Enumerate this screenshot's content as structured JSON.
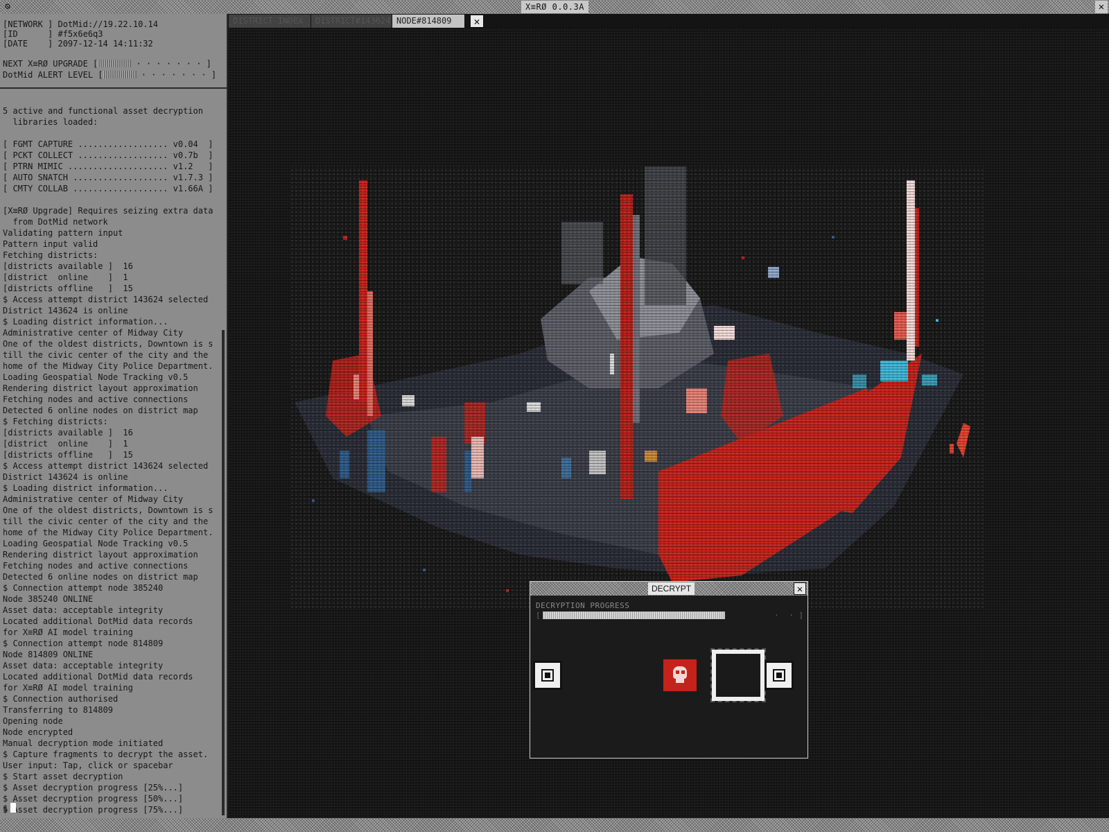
{
  "app": {
    "title": "X≡RØ 0.0.3A",
    "icon": "gear-icon",
    "close_icon": "close-icon"
  },
  "status": {
    "network": "[NETWORK ] DotMid://19.22.10.14",
    "id": "[ID      ] #f5x6e6q3",
    "date": "[DATE    ] 2097-12-14 14:11:32",
    "upgrade_label": "NEXT X≡RØ UPGRADE [",
    "upgrade_dots": " · · · · · · · ]",
    "upgrade_progress": 0.3,
    "alert_label": "DotMid ALERT LEVEL [",
    "alert_dots": " · · · · · · · ]",
    "alert_progress": 0.3
  },
  "log": {
    "lines": [
      "5 active and functional asset decryption",
      "  libraries loaded:",
      "",
      "[ FGMT CAPTURE .................. v0.04  ]",
      "[ PCKT COLLECT .................. v0.7b  ]",
      "[ PTRN MIMIC .................... v1.2   ]",
      "[ AUTO SNATCH ................... v1.7.3 ]",
      "[ CMTY COLLAB ................... v1.66A ]",
      "",
      "[X≡RØ Upgrade] Requires seizing extra data",
      "  from DotMid network",
      "Validating pattern input",
      "Pattern input valid",
      "Fetching districts:",
      "[districts available ]  16",
      "[district  online    ]  1",
      "[districts offline   ]  15",
      "$ Access attempt district 143624 selected",
      "District 143624 is online",
      "$ Loading district information...",
      "Administrative center of Midway City",
      "One of the oldest districts, Downtown is s",
      "till the civic center of the city and the",
      "home of the Midway City Police Department.",
      "Loading Geospatial Node Tracking v0.5",
      "Rendering district layout approximation",
      "Fetching nodes and active connections",
      "Detected 6 online nodes on district map",
      "$ Fetching districts:",
      "[districts available ]  16",
      "[district  online    ]  1",
      "[districts offline   ]  15",
      "$ Access attempt district 143624 selected",
      "District 143624 is online",
      "$ Loading district information...",
      "Administrative center of Midway City",
      "One of the oldest districts, Downtown is s",
      "till the civic center of the city and the",
      "home of the Midway City Police Department.",
      "Loading Geospatial Node Tracking v0.5",
      "Rendering district layout approximation",
      "Fetching nodes and active connections",
      "Detected 6 online nodes on district map",
      "$ Connection attempt node 385240",
      "Node 385240 ONLINE",
      "Asset data: acceptable integrity",
      "Located additional DotMid data records",
      "for X≡RØ AI model training",
      "$ Connection attempt node 814809",
      "Node 814809 ONLINE",
      "Asset data: acceptable integrity",
      "Located additional DotMid data records",
      "for X≡RØ AI model training",
      "$ Connection authorised",
      "Transferring to 814809",
      "Opening node",
      "Node encrypted",
      "Manual decryption mode initiated",
      "$ Capture fragments to decrypt the asset.",
      "User input: Tap, click or spacebar",
      "$ Start asset decryption",
      "$ Asset decryption progress [25%...]",
      "$ Asset decryption progress [50%...]",
      "$ Asset decryption progress [75%...]"
    ],
    "prompt": "$"
  },
  "tabs": [
    {
      "label": "DISTRICT INDEX",
      "active": false
    },
    {
      "label": "DISTRICT#143624",
      "active": false
    },
    {
      "label": "NODE#814809",
      "active": true
    }
  ],
  "dialog": {
    "title": "DECRYPT",
    "progress_label": "DECRYPTION PROGRESS",
    "progress_value": 0.75,
    "bracket_left": "[",
    "bracket_right": "]",
    "progress_dots": "· ·",
    "fragment_icon": "fragment-chip-icon",
    "hazard_icon": "skull-icon",
    "close_icon": "close-icon"
  },
  "colors": {
    "accent_red": "#c4221b",
    "accent_cyan": "#3fb6d6",
    "panel_gray": "#8c8c8c"
  }
}
